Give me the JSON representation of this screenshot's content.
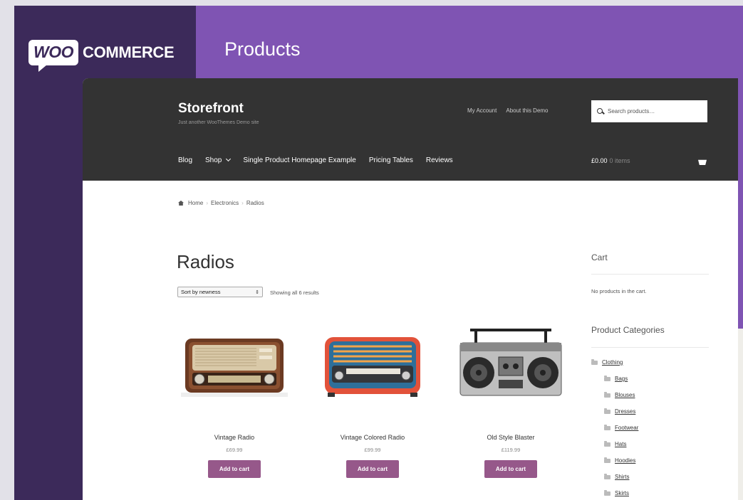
{
  "brand": {
    "woo": "WOO",
    "commerce": "COMMERCE"
  },
  "page_title": "Products",
  "storefront": {
    "title": "Storefront",
    "tagline": "Just another WooThemes Demo site",
    "secondary_nav": [
      "My Account",
      "About this Demo"
    ],
    "search_placeholder": "Search products…",
    "main_nav": [
      "Blog",
      "Shop",
      "Single Product Homepage Example",
      "Pricing Tables",
      "Reviews"
    ],
    "cart_total": "£0.00",
    "cart_items": "0 items"
  },
  "breadcrumb": [
    "Home",
    "Electronics",
    "Radios"
  ],
  "heading": "Radios",
  "sort": {
    "selected": "Sort by newness"
  },
  "result_count": "Showing all 6 results",
  "products": [
    {
      "name": "Vintage Radio",
      "price": "£69.99",
      "button": "Add to cart"
    },
    {
      "name": "Vintage Colored Radio",
      "price": "£99.99",
      "button": "Add to cart"
    },
    {
      "name": "Old Style Blaster",
      "price": "£119.99",
      "button": "Add to cart"
    }
  ],
  "sidebar": {
    "cart_title": "Cart",
    "cart_empty": "No products in the cart.",
    "categories_title": "Product Categories",
    "categories": [
      "Clothing",
      "Bags",
      "Blouses",
      "Dresses",
      "Footwear",
      "Hats",
      "Hoodies",
      "Shirts",
      "Skirts"
    ]
  },
  "colors": {
    "purple": "#7f54b3",
    "dark_purple": "#3c2a5a",
    "header": "#333333",
    "button": "#96588a"
  }
}
